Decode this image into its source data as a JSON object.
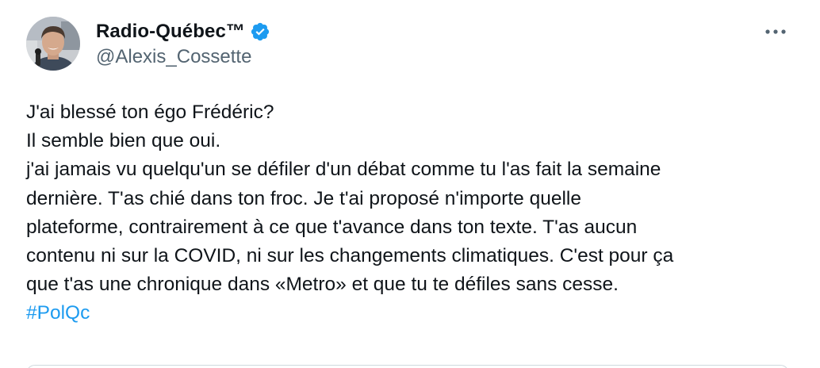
{
  "author": {
    "display_name": "Radio-Québec™",
    "handle": "@Alexis_Cossette",
    "verified": true,
    "verified_color": "#1d9bf0",
    "avatar_icon": "user-avatar"
  },
  "actions": {
    "more_icon": "more-horizontal-icon"
  },
  "tweet": {
    "lines": [
      "J'ai blessé ton égo Frédéric?",
      "Il semble bien que oui.",
      "j'ai jamais vu quelqu'un se défiler d'un débat comme tu l'as fait la semaine",
      "dernière. T'as chié dans ton froc. Je t'ai proposé n'importe quelle",
      "plateforme, contrairement à ce que t'avance dans ton texte. T'as aucun",
      "contenu ni sur la COVID, ni sur les changements climatiques. C'est pour ça",
      "que t'as une chronique dans «Metro» et que tu te défiles sans cesse."
    ],
    "hashtag": "#PolQc",
    "hashtag_color": "#1d9bf0"
  }
}
